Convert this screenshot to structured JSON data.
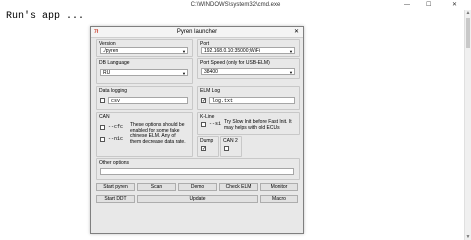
{
  "cmd": {
    "title": "C:\\WINDOWS\\system32\\cmd.exe",
    "text": "Run's app ...",
    "minimize_glyph": "—",
    "maximize_glyph": "☐",
    "close_glyph": "✕"
  },
  "dialog": {
    "title": "Pyren launcher",
    "close_glyph": "✕",
    "version": {
      "label": "Version",
      "value": "./pyren"
    },
    "db_language": {
      "label": "DB Language",
      "value": "RU"
    },
    "port": {
      "label": "Port",
      "value": "192.168.0.10:35000;WiFi"
    },
    "port_speed": {
      "label": "Port Speed (only for USB-ELM)",
      "value": "38400"
    },
    "data_logging": {
      "label": "Data logging",
      "value": "csv"
    },
    "elm_log": {
      "label": "ELM Log",
      "value": "log.txt"
    },
    "can": {
      "label": "CAN",
      "opt1": "--cfc",
      "opt2": "--n1c",
      "note": "These options should be enabled for some fake chinese ELM. Any of them decrease data rate."
    },
    "kline": {
      "label": "K-Line",
      "opt": "--si",
      "note": "Try Slow Init before Fast Init. It may helps with old ECUs"
    },
    "dump": {
      "label": "Dump"
    },
    "can2": {
      "label": "CAN 2"
    },
    "other_options": {
      "label": "Other options",
      "value": ""
    },
    "buttons": {
      "start_pyren": "Start pyren",
      "scan": "Scan",
      "demo": "Demo",
      "check_elm": "Check ELM",
      "monitor": "Monitor",
      "start_ddt": "Start DDT",
      "update": "Update",
      "macro": "Macro"
    }
  }
}
